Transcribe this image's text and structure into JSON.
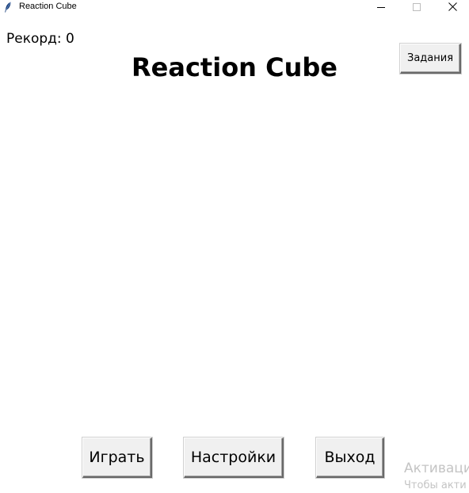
{
  "window": {
    "title": "Reaction Cube",
    "icon": "feather-icon",
    "controls": {
      "minimize_icon": "minimize-icon",
      "maximize_icon": "maximize-icon",
      "close_icon": "close-icon"
    }
  },
  "header": {
    "record_label": "Рекорд: 0",
    "title": "Reaction Cube"
  },
  "buttons": {
    "tasks": "Задания",
    "play": "Играть",
    "settings": "Настройки",
    "exit": "Выход"
  },
  "watermark": {
    "line1": "Активаци",
    "line2": "Чтобы акти"
  },
  "colors": {
    "background": "#ffffff",
    "button_face": "#f0f0f0",
    "button_shadow": "#696969",
    "watermark_text": "#c4c4c4"
  }
}
